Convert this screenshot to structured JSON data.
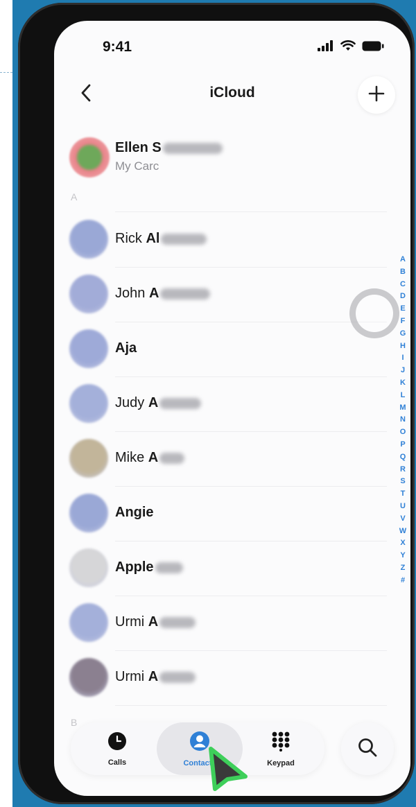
{
  "status_bar": {
    "time": "9:41",
    "icons": [
      "signal-icon",
      "wifi-icon",
      "battery-icon"
    ]
  },
  "nav": {
    "back_icon": "chevron-left-icon",
    "title": "iCloud",
    "add_icon": "plus-icon"
  },
  "my_card": {
    "name": "Ellen S",
    "subtitle": "My Carc"
  },
  "section_letters": {
    "a": "A",
    "b": "B"
  },
  "contacts": [
    {
      "first": "Rick",
      "last": "Al",
      "redacted": true
    },
    {
      "first": "John",
      "last": "A",
      "redacted": true
    },
    {
      "first": "Aja",
      "last": "",
      "redacted": false
    },
    {
      "first": "Judy",
      "last": "A",
      "redacted": true
    },
    {
      "first": "Mike",
      "last": "A",
      "redacted": true
    },
    {
      "first": "Angie",
      "last": "",
      "redacted": false
    },
    {
      "first": "Apple",
      "last": "",
      "redacted": true
    },
    {
      "first": "Urmi",
      "last": "A",
      "redacted": true
    },
    {
      "first": "Urmi",
      "last": "A",
      "redacted": true
    }
  ],
  "index_letters": [
    "A",
    "B",
    "C",
    "D",
    "E",
    "F",
    "G",
    "H",
    "I",
    "J",
    "K",
    "L",
    "M",
    "N",
    "O",
    "P",
    "Q",
    "R",
    "S",
    "T",
    "U",
    "V",
    "W",
    "X",
    "Y",
    "Z",
    "#"
  ],
  "tab_bar": {
    "tabs": [
      {
        "label": "Calls",
        "icon": "clock-icon",
        "active": false
      },
      {
        "label": "Contacts",
        "icon": "person-circle-icon",
        "active": true
      },
      {
        "label": "Keypad",
        "icon": "keypad-icon",
        "active": false
      }
    ],
    "search_icon": "search-icon"
  },
  "colors": {
    "accent": "#2f80d6",
    "background": "#1f7bb0",
    "cursor_outline": "#3ecf5a"
  }
}
